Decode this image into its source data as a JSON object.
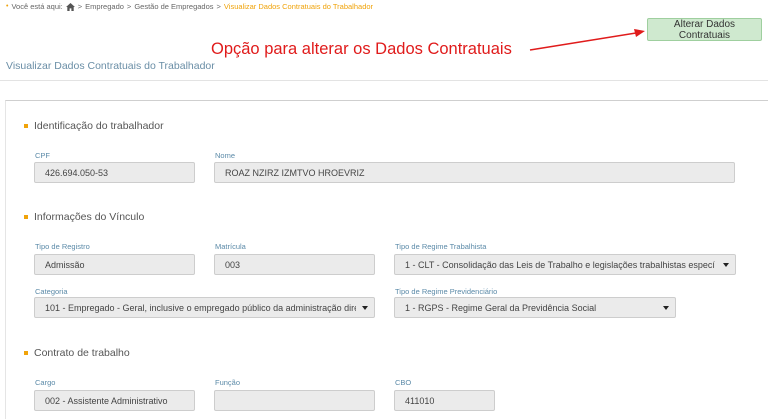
{
  "breadcrumb": {
    "prefix": "Você está aqui:",
    "items": [
      "Empregado",
      "Gestão de Empregados"
    ],
    "separator": ">",
    "current": "Visualizar Dados Contratuais do Trabalhador"
  },
  "actions": {
    "alter_label": "Alterar Dados Contratuais"
  },
  "annotation": {
    "text": "Opção para alterar os Dados Contratuais",
    "color": "#e01b1b"
  },
  "page_title": "Visualizar Dados Contratuais do Trabalhador",
  "sections": {
    "identificacao": {
      "title": "Identificação do trabalhador",
      "cpf_label": "CPF",
      "cpf_value": "426.694.050-53",
      "nome_label": "Nome",
      "nome_value": "ROAZ NZIRZ IZMTVO HROEVRIZ"
    },
    "vinculo": {
      "title": "Informações do Vínculo",
      "tipo_registro_label": "Tipo de Registro",
      "tipo_registro_value": "Admissão",
      "matricula_label": "Matrícula",
      "matricula_value": "003",
      "regime_trabalhista_label": "Tipo de Regime Trabalhista",
      "regime_trabalhista_value": "1 - CLT - Consolidação das Leis de Trabalho e legislações trabalhistas especí",
      "categoria_label": "Categoria",
      "categoria_value": "101 - Empregado - Geral, inclusive o empregado público da administração dire",
      "regime_previdenciario_label": "Tipo de Regime Previdenciário",
      "regime_previdenciario_value": "1 - RGPS - Regime Geral da Previdência Social"
    },
    "contrato": {
      "title": "Contrato de trabalho",
      "cargo_label": "Cargo",
      "cargo_value": "002 - Assistente Administrativo",
      "funcao_label": "Função",
      "funcao_value": "",
      "cbo_label": "CBO",
      "cbo_value": "411010"
    }
  },
  "colors": {
    "accent_orange": "#f0a30a",
    "label_blue": "#5b8aa8",
    "button_green": "#cfe9cf"
  }
}
